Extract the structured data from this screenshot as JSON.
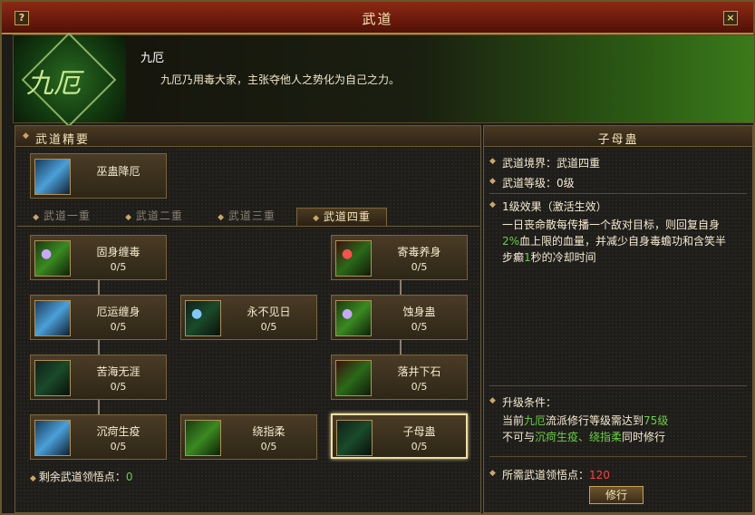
{
  "window": {
    "title": "武道",
    "help_label": "?",
    "close_label": "×"
  },
  "school": {
    "emblem_text": "九厄",
    "name": "九厄",
    "description": "九厄乃用毒大家，主张夺他人之势化为自己之力。"
  },
  "left_panel": {
    "title": "武道精要",
    "essence_skill": {
      "name": "巫蛊降厄",
      "icon": "blue-spirit-icon"
    },
    "tabs": [
      "武道一重",
      "武道二重",
      "武道三重",
      "武道四重"
    ],
    "active_tab": 3,
    "skills": [
      {
        "name": "固身缠毒",
        "level": "0/5",
        "icon": "poison-hand-icon"
      },
      {
        "name": "寄毒养身",
        "level": "0/5",
        "icon": "red-claw-icon"
      },
      {
        "name": "厄运缠身",
        "level": "0/5",
        "icon": "blue-arm-icon"
      },
      {
        "name": "永不见日",
        "level": "0/5",
        "icon": "dark-arm-icon"
      },
      {
        "name": "蚀身蛊",
        "level": "0/5",
        "icon": "purple-arm-icon"
      },
      {
        "name": "苦海无涯",
        "level": "0/5",
        "icon": "claw-icon"
      },
      {
        "name": "落井下石",
        "level": "0/5",
        "icon": "red-figure-icon"
      },
      {
        "name": "沉疴生疫",
        "level": "0/5",
        "icon": "blue-slash-icon"
      },
      {
        "name": "绕指柔",
        "level": "0/5",
        "icon": "green-hand-icon"
      },
      {
        "name": "子母蛊",
        "level": "0/5",
        "icon": "dark-figure-icon"
      }
    ],
    "remaining_points_label": "剩余武道领悟点：",
    "remaining_points_value": "0"
  },
  "right_panel": {
    "title": "子母蛊",
    "realm_label": "武道境界：",
    "realm_value": "武道四重",
    "grade_label": "武道等级：",
    "grade_value": "0级",
    "effect_title": "1级效果（激活生效）",
    "effect_line1": "一日丧命散每传播一个敌对目标，则回复自身",
    "effect_line2_value": "2%",
    "effect_line2_rest": "血上限的血量，并减少自身毒蟾功和含笑半",
    "effect_line3_pre": "步癫",
    "effect_line3_value": "1",
    "effect_line3_rest": "秒的冷却时间",
    "upgrade_title": "升级条件：",
    "req1_pre": "当前",
    "req1_school": "九厄",
    "req1_mid": "流派修行等级需达到",
    "req1_level": "75级",
    "req2_pre": "不可与",
    "req2_skills": "沉疴生疫、绕指柔",
    "req2_rest": "同时修行",
    "points_needed_label": "所需武道领悟点：",
    "points_needed_value": "120",
    "train_button": "修行"
  }
}
